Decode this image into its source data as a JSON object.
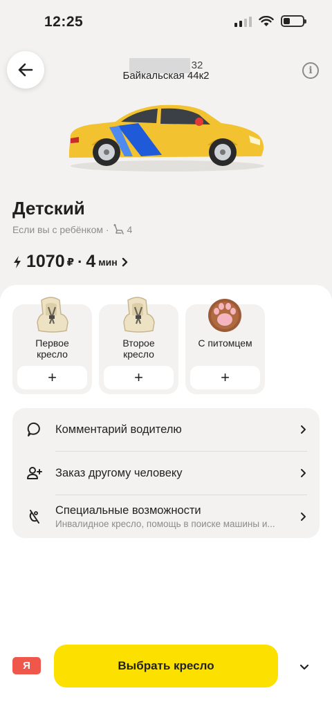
{
  "status_bar": {
    "time": "12:25"
  },
  "header": {
    "address_line_1_visible": "32",
    "address_line_2": "Байкальская 44к2",
    "info_label": "i"
  },
  "tariff": {
    "title": "Детский",
    "subtitle": "Если вы с ребёнком ·",
    "seats": "4",
    "price": "1070",
    "currency": "₽",
    "separator": "·",
    "eta": "4",
    "eta_unit": "мин"
  },
  "options": [
    {
      "label_1": "Первое",
      "label_2": "кресло",
      "add": "+"
    },
    {
      "label_1": "Второе",
      "label_2": "кресло",
      "add": "+"
    },
    {
      "label_1": "С питомцем",
      "label_2": "",
      "add": "+"
    }
  ],
  "list": {
    "comment": {
      "title": "Комментарий водителю"
    },
    "other_person": {
      "title": "Заказ другому человеку"
    },
    "accessibility": {
      "title": "Специальные возможности",
      "subtitle": "Инвалидное кресло, помощь в поиске машины и..."
    }
  },
  "footer": {
    "badge": "Я",
    "cta_label": "Выбрать кресло"
  },
  "colors": {
    "accent_yellow": "#fce000",
    "badge_red": "#f0574b",
    "background": "#f3f2f0",
    "car_yellow": "#f2c230",
    "stripe_blue": "#1f5ad8"
  }
}
